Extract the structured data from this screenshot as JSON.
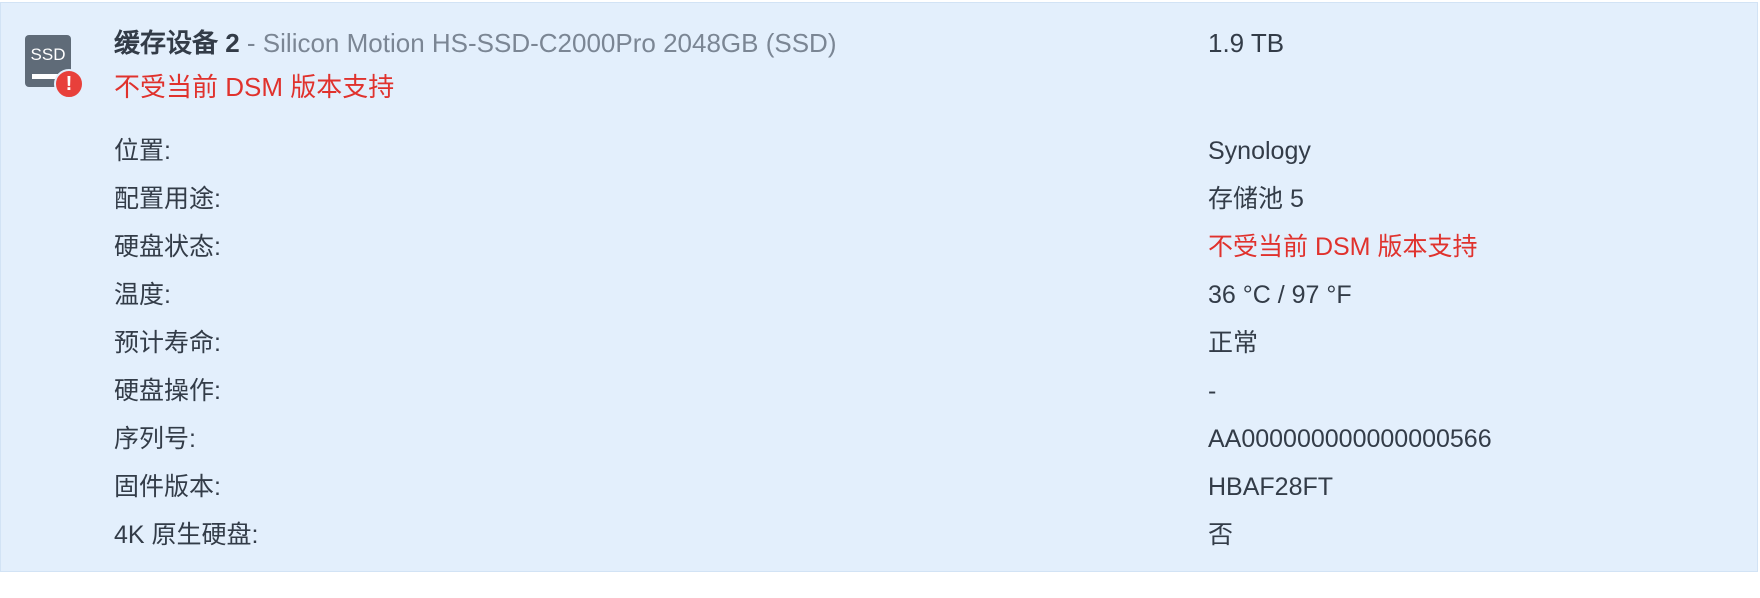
{
  "device": {
    "name": "缓存设备 2",
    "separator": " - ",
    "model": "Silicon Motion HS-SSD-C2000Pro 2048GB (SSD)",
    "status": "不受当前 DSM 版本支持",
    "capacity": "1.9 TB",
    "icon": "ssd-drive-icon",
    "icon_text": "SSD",
    "badge_icon": "warning-icon",
    "badge_text": "!"
  },
  "details": [
    {
      "label": "位置:",
      "value": "Synology"
    },
    {
      "label": "配置用途:",
      "value": "存储池 5"
    },
    {
      "label": "硬盘状态:",
      "value": "不受当前 DSM 版本支持"
    },
    {
      "label": "温度:",
      "value": "36 °C / 97 °F"
    },
    {
      "label": "预计寿命:",
      "value": "正常"
    },
    {
      "label": "硬盘操作:",
      "value": "-"
    },
    {
      "label": "序列号:",
      "value": "AA000000000000000566"
    },
    {
      "label": "固件版本:",
      "value": "HBAF28FT"
    },
    {
      "label": "4K 原生硬盘:",
      "value": "否"
    }
  ],
  "colors": {
    "panel_bg": "#e3effc",
    "text": "#333c48",
    "muted": "#7b8694",
    "error": "#e0322d",
    "icon_body": "#5f6b78"
  }
}
